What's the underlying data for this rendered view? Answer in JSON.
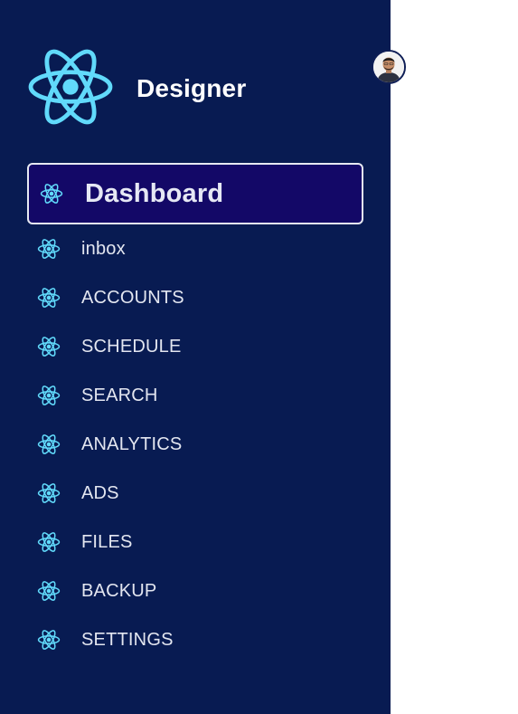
{
  "brand": {
    "name": "Designer",
    "logo_icon": "react-atom-icon",
    "logo_color": "#61dafb"
  },
  "user": {
    "avatar_icon": "user-avatar-icon"
  },
  "nav": {
    "active_item": "dashboard",
    "items": [
      {
        "key": "dashboard",
        "label": "Dashboard",
        "icon": "react-atom-icon"
      },
      {
        "key": "inbox",
        "label": "inbox",
        "icon": "react-atom-icon"
      },
      {
        "key": "accounts",
        "label": "ACCOUNTS",
        "icon": "react-atom-icon"
      },
      {
        "key": "schedule",
        "label": "SCHEDULE",
        "icon": "react-atom-icon"
      },
      {
        "key": "search",
        "label": "SEARCH",
        "icon": "react-atom-icon"
      },
      {
        "key": "analytics",
        "label": "ANALYTICS",
        "icon": "react-atom-icon"
      },
      {
        "key": "ads",
        "label": "ADS",
        "icon": "react-atom-icon"
      },
      {
        "key": "files",
        "label": "FILES",
        "icon": "react-atom-icon"
      },
      {
        "key": "backup",
        "label": "BACKUP",
        "icon": "react-atom-icon"
      },
      {
        "key": "settings",
        "label": "SETTINGS",
        "icon": "react-atom-icon"
      }
    ]
  },
  "colors": {
    "sidebar_bg": "#081b52",
    "active_bg": "#130867",
    "icon": "#61dafb",
    "text": "#e3e6f0"
  }
}
